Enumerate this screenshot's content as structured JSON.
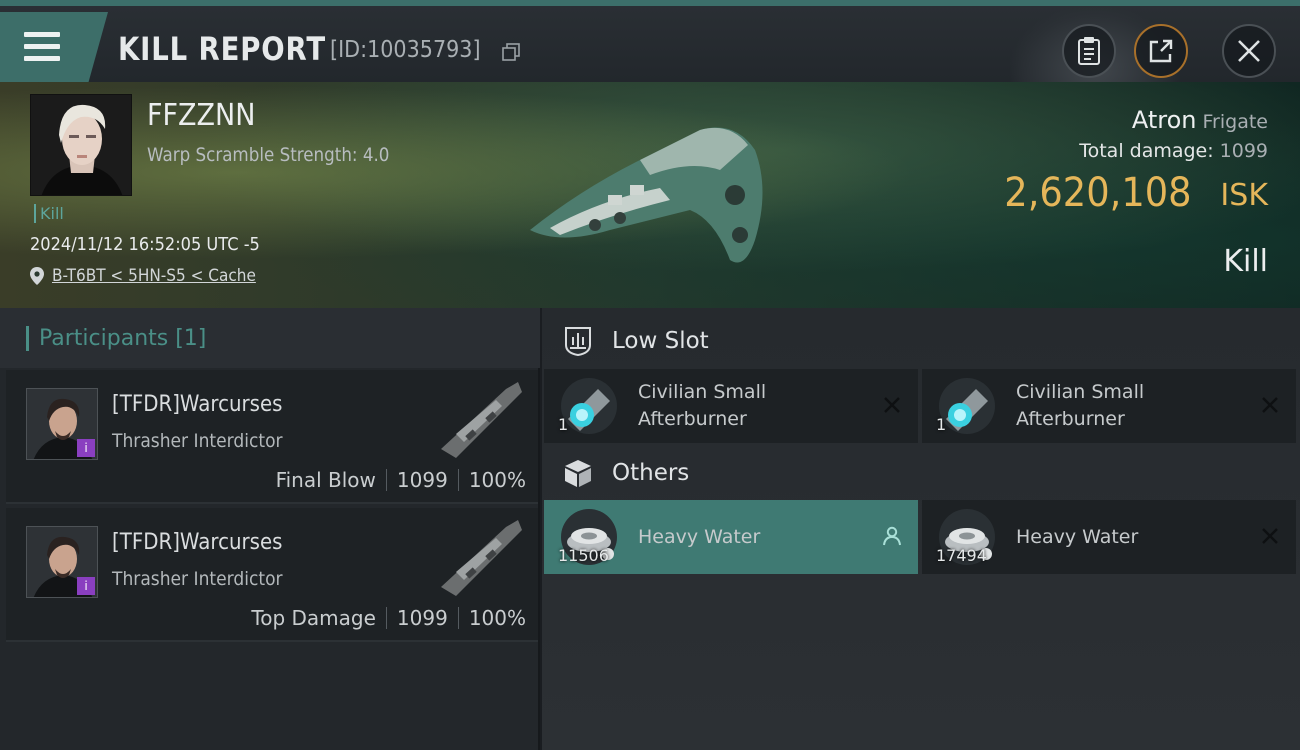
{
  "header": {
    "title": "KILL REPORT",
    "report_id": "[ID:10035793]"
  },
  "victim": {
    "name": "FFZZNN",
    "warp_scramble": "Warp Scramble Strength: 4.0",
    "tag": "Kill",
    "datetime": "2024/11/12 16:52:05 UTC -5",
    "location": "B-T6BT < 5HN-S5 < Cache"
  },
  "ship": {
    "name": "Atron",
    "class": "Frigate",
    "total_damage_label": "Total damage:",
    "total_damage": "1099",
    "isk_value": "2,620,108",
    "isk_unit": "ISK",
    "result": "Kill"
  },
  "participants": {
    "title": "Participants [1]",
    "items": [
      {
        "name": "[TFDR]Warcurses",
        "ship": "Thrasher Interdictor",
        "role": "Final Blow",
        "damage": "1099",
        "percent": "100%"
      },
      {
        "name": "[TFDR]Warcurses",
        "ship": "Thrasher Interdictor",
        "role": "Top Damage",
        "damage": "1099",
        "percent": "100%"
      }
    ]
  },
  "fittings": {
    "low_slot": {
      "title": "Low Slot",
      "items": [
        {
          "name_line1": "Civilian Small",
          "name_line2": "Afterburner",
          "qty": "1",
          "action": "close-icon"
        },
        {
          "name_line1": "Civilian Small",
          "name_line2": "Afterburner",
          "qty": "1",
          "action": "close-icon"
        }
      ]
    },
    "others": {
      "title": "Others",
      "items": [
        {
          "name": "Heavy Water",
          "qty": "11506",
          "action": "person-icon"
        },
        {
          "name": "Heavy Water",
          "qty": "17494",
          "action": "close-icon"
        }
      ]
    }
  },
  "colors": {
    "accent_teal": "#3d6e69",
    "isk_gold": "#e5b65a",
    "active_item": "#3f7a73",
    "badge_purple": "#8a3fc0"
  }
}
